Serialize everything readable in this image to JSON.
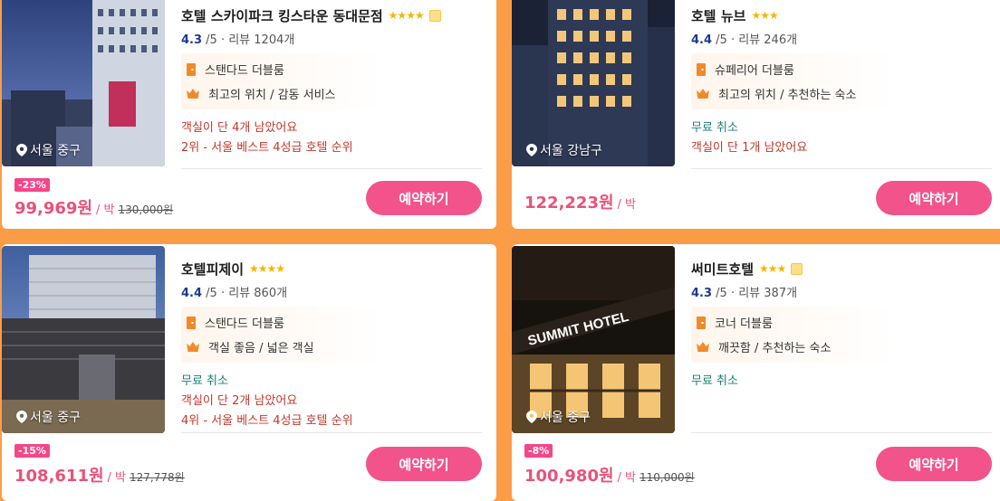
{
  "hotels": [
    {
      "name": "호텔 스카이파크 킹스타운 동대문점",
      "stars": "★★★★",
      "rating": "4.3",
      "rating_suffix": "/5 · 리뷰 1204개",
      "room": "스탠다드 더블룸",
      "highlight": "최고의 위치 / 감동 서비스",
      "free_cancel": "",
      "notes": [
        "객실이 단 4개 남았어요",
        "2위 - 서울 베스트 4성급 호텔 순위"
      ],
      "location": "서울 중구",
      "discount": "-23%",
      "price": "99,969원",
      "per_night": "/ 박",
      "original_price": "130,000원",
      "book_label": "예약하기"
    },
    {
      "name": "호텔 뉴브",
      "stars": "★★★",
      "rating": "4.4",
      "rating_suffix": "/5 · 리뷰 246개",
      "room": "슈페리어 더블룸",
      "highlight": "최고의 위치 / 추천하는 숙소",
      "free_cancel": "무료 취소",
      "notes": [
        "객실이 단 1개 남았어요"
      ],
      "location": "서울 강남구",
      "discount": "",
      "price": "122,223원",
      "per_night": "/ 박",
      "original_price": "",
      "book_label": "예약하기"
    },
    {
      "name": "호텔피제이",
      "stars": "★★★★",
      "rating": "4.4",
      "rating_suffix": "/5 · 리뷰 860개",
      "room": "스탠다드 더블룸",
      "highlight": "객실 좋음 / 넓은 객실",
      "free_cancel": "무료 취소",
      "notes": [
        "객실이 단 2개 남았어요",
        "4위 - 서울 베스트 4성급 호텔 순위"
      ],
      "location": "서울 중구",
      "discount": "-15%",
      "price": "108,611원",
      "per_night": "/ 박",
      "original_price": "127,778원",
      "book_label": "예약하기"
    },
    {
      "name": "써미트호텔",
      "stars": "★★★",
      "rating": "4.3",
      "rating_suffix": "/5 · 리뷰 387개",
      "room": "코너 더블룸",
      "highlight": "깨끗함 / 추천하는 숙소",
      "free_cancel": "무료 취소",
      "notes": [],
      "location": "서울 중구",
      "discount": "-8%",
      "price": "100,980원",
      "per_night": "/ 박",
      "original_price": "110,000원",
      "book_label": "예약하기",
      "photo_sign": "SUMMIT HOTEL"
    }
  ],
  "colors": {
    "page_bg": "#fb9d47",
    "price": "#e8527a",
    "button": "#f2538a",
    "discount_badge": "#f6468a",
    "rating_score": "#1f3a93",
    "free_cancel": "#1a7f7a",
    "alert": "#c0392b",
    "star": "#f8b500"
  },
  "icons": {
    "location": "map-pin-icon",
    "room": "door-icon",
    "highlight": "crown-icon",
    "star": "star-icon"
  }
}
